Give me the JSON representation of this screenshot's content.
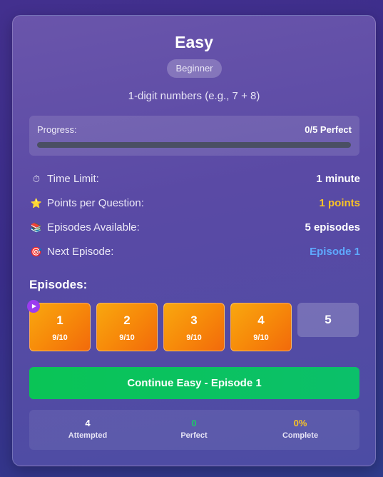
{
  "card": {
    "title": "Easy",
    "level": "Beginner",
    "description": "1-digit numbers (e.g., 7 + 8)"
  },
  "progress": {
    "label": "Progress:",
    "value": "0/5 Perfect",
    "fraction": 0
  },
  "info": [
    {
      "icon": "stopwatch-icon",
      "label": "Time Limit:",
      "value": "1 minute",
      "color": "#ffffff"
    },
    {
      "icon": "star-icon",
      "label": "Points per Question:",
      "value": "1 points",
      "color": "#f8c326"
    },
    {
      "icon": "books-icon",
      "label": "Episodes Available:",
      "value": "5 episodes",
      "color": "#ffffff"
    },
    {
      "icon": "target-icon",
      "label": "Next Episode:",
      "value": "Episode 1",
      "color": "#5fa9ff"
    }
  ],
  "episodes": {
    "title": "Episodes:",
    "items": [
      {
        "number": "1",
        "score": "9/10",
        "status": "completed"
      },
      {
        "number": "2",
        "score": "9/10",
        "status": "completed"
      },
      {
        "number": "3",
        "score": "9/10",
        "status": "completed"
      },
      {
        "number": "4",
        "score": "9/10",
        "status": "completed"
      },
      {
        "number": "5",
        "score": "",
        "status": "locked"
      }
    ]
  },
  "continue_button": "Continue Easy - Episode 1",
  "stats": [
    {
      "value": "4",
      "label": "Attempted",
      "color": "#ffffff"
    },
    {
      "value": "0",
      "label": "Perfect",
      "color": "#1ec66a"
    },
    {
      "value": "0%",
      "label": "Complete",
      "color": "#f8c326"
    }
  ]
}
